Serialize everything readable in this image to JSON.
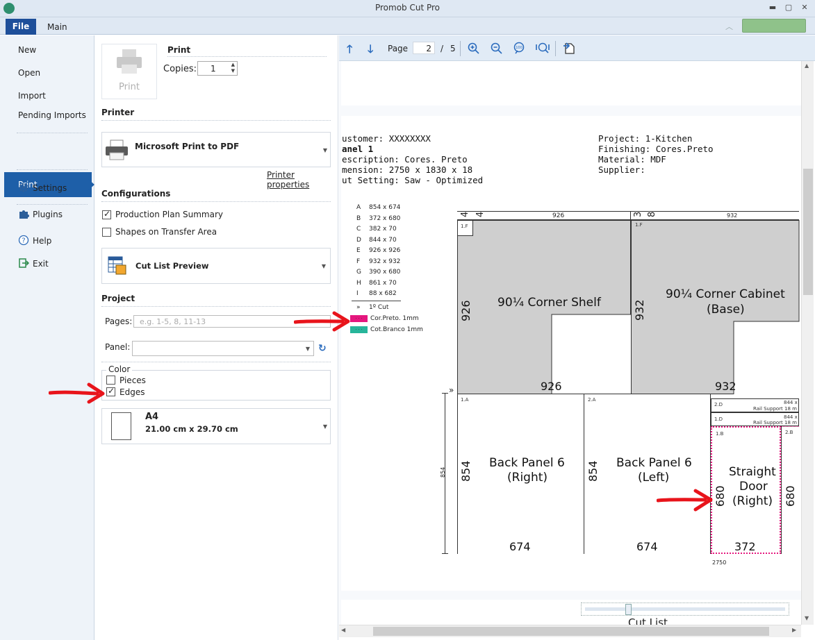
{
  "app": {
    "title": "Promob Cut Pro"
  },
  "ribbon": {
    "tabs": [
      {
        "label": "File"
      },
      {
        "label": "Main"
      }
    ]
  },
  "backstage": {
    "items": [
      "New",
      "Open",
      "Import",
      "Pending Imports"
    ],
    "active": "Print",
    "items2": [
      "Settings",
      "Plugins",
      "Help",
      "Exit"
    ]
  },
  "print_panel": {
    "print_button_label": "Print",
    "print_title": "Print",
    "copies_label": "Copies:",
    "copies_value": "1",
    "printer_section": "Printer",
    "printer_name": "Microsoft Print to PDF",
    "printer_properties": "Printer properties",
    "configurations_section": "Configurations",
    "production_plan_summary": "Production Plan Summary",
    "shapes_on_transfer_area": "Shapes on Transfer Area",
    "report_type": "Cut List Preview",
    "project_section": "Project",
    "pages_label": "Pages:",
    "pages_placeholder": "e.g. 1-5, 8, 11-13",
    "panel_label": "Panel:",
    "color_group": "Color",
    "pieces_label": "Pieces",
    "edges_label": "Edges",
    "paper_name": "A4",
    "paper_size": "21.00 cm x 29.70 cm"
  },
  "preview_toolbar": {
    "page_label": "Page",
    "page_current": "2",
    "page_sep": "/",
    "page_total": "5"
  },
  "sheet": {
    "header_left": [
      "ustomer: XXXXXXXX",
      "anel 1",
      "escription: Cores. Preto",
      "mension: 2750 x 1830 x 18",
      "ut Setting: Saw - Optimized"
    ],
    "header_right": [
      "Project: 1-Kitchen",
      "Finishing: Cores.Preto",
      "Material: MDF",
      "Supplier:"
    ],
    "legend": [
      {
        "key": "A",
        "value": "854 x 674"
      },
      {
        "key": "B",
        "value": "372 x 680"
      },
      {
        "key": "C",
        "value": "382 x 70"
      },
      {
        "key": "D",
        "value": "844 x 70"
      },
      {
        "key": "E",
        "value": "926 x 926"
      },
      {
        "key": "F",
        "value": "932 x 932"
      },
      {
        "key": "G",
        "value": "390 x 680"
      },
      {
        "key": "H",
        "value": "861 x 70"
      },
      {
        "key": "I",
        "value": "88 x 682"
      }
    ],
    "legend_cut": {
      "key": "»",
      "value": "1º Cut"
    },
    "edge_legend": [
      {
        "label": "Cor.Preto.  1mm",
        "color": "#e5177e"
      },
      {
        "label": "Cot.Branco  1mm",
        "color": "#27b59a"
      }
    ],
    "top_dims": {
      "a": "4",
      "b": "4",
      "c": "926",
      "d": "3",
      "e": "8",
      "f": "932"
    },
    "pieces": {
      "corner_shelf": {
        "code": "1.F",
        "line1": "90¼ Corner Shelf",
        "h": "926",
        "w": "926"
      },
      "corner_cabinet": {
        "code": "1.F",
        "line1": "90¼ Corner Cabinet",
        "line2": "(Base)",
        "h": "932",
        "w": "932"
      },
      "back_right": {
        "code": "1.A",
        "line1": "Back Panel 6",
        "line2": "(Right)",
        "h": "854",
        "w": "674"
      },
      "back_left": {
        "code": "2.A",
        "line1": "Back Panel 6",
        "line2": "(Left)",
        "h": "854",
        "w": "674"
      },
      "strip1": {
        "code": "2.D",
        "dim": "844 x",
        "text": "Rail Support 18 m"
      },
      "strip2": {
        "code": "1.D",
        "dim": "844 x",
        "text": "Rail Support 18 m"
      },
      "door": {
        "code": "1.B",
        "line1": "Straight",
        "line2": "Door",
        "line3": "(Right)",
        "h": "680",
        "w": "372"
      },
      "next": {
        "code": "2.B",
        "h": "680"
      }
    },
    "cut_marker": "»",
    "left_dim": "854",
    "bottom_dim": "2750",
    "cut_list_label": "Cut List"
  },
  "colors": {
    "accent": "#1e5fa8",
    "edge_pink": "#e5177e",
    "edge_teal": "#27b59a",
    "arrow_red": "#e8141b"
  }
}
